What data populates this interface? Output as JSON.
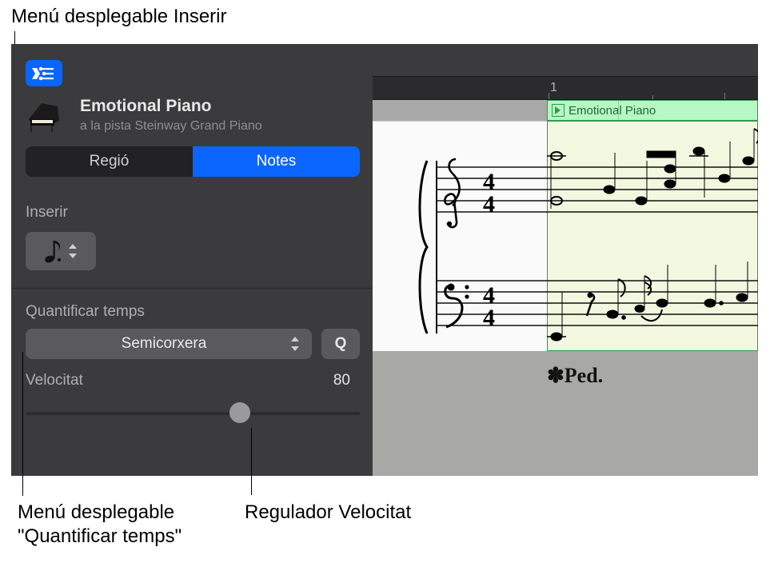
{
  "callouts": {
    "insert": "Menú desplegable Inserir",
    "quantize": "Menú desplegable\n\"Quantificar temps\"",
    "velocity": "Regulador Velocitat"
  },
  "header": {
    "title": "Emotional Piano",
    "subtitle": "a la pista Steinway Grand Piano"
  },
  "tabs": {
    "region": "Regió",
    "notes": "Notes"
  },
  "insert": {
    "label": "Inserir",
    "icon_name": "dotted-eighth-note-icon"
  },
  "quantize": {
    "label": "Quantificar temps",
    "value": "Semicorxera",
    "q_button": "Q"
  },
  "velocity": {
    "label": "Velocitat",
    "value": "80"
  },
  "ruler": {
    "marker1": "1"
  },
  "region": {
    "name": "Emotional Piano"
  },
  "pedal": {
    "mark": "✽Ped."
  }
}
